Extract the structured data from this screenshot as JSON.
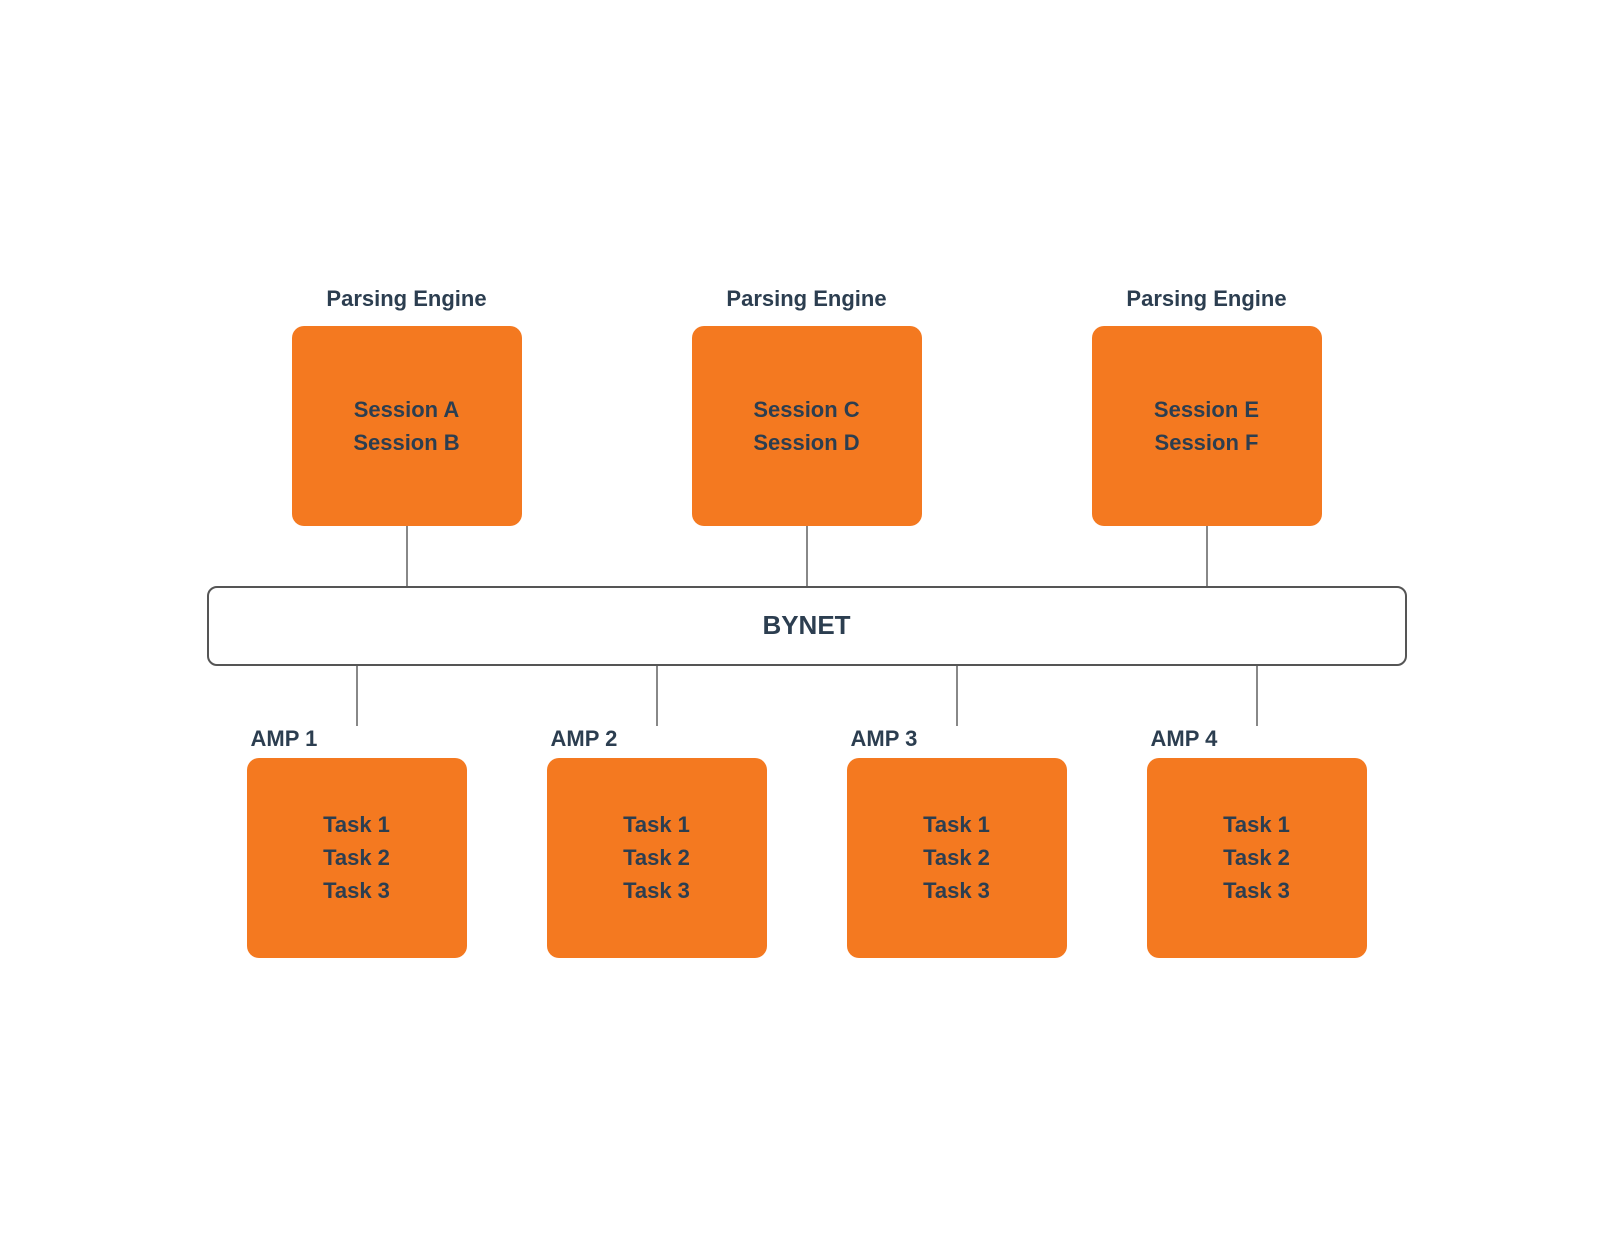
{
  "diagram": {
    "parsing_engines": [
      {
        "label": "Parsing Engine",
        "sessions": [
          "Session A",
          "Session B"
        ]
      },
      {
        "label": "Parsing Engine",
        "sessions": [
          "Session C",
          "Session D"
        ]
      },
      {
        "label": "Parsing Engine",
        "sessions": [
          "Session E",
          "Session F"
        ]
      }
    ],
    "bynet_label": "BYNET",
    "amps": [
      {
        "label": "AMP 1",
        "tasks": [
          "Task 1",
          "Task 2",
          "Task 3"
        ]
      },
      {
        "label": "AMP 2",
        "tasks": [
          "Task 1",
          "Task 2",
          "Task 3"
        ]
      },
      {
        "label": "AMP 3",
        "tasks": [
          "Task 1",
          "Task 2",
          "Task 3"
        ]
      },
      {
        "label": "AMP 4",
        "tasks": [
          "Task 1",
          "Task 2",
          "Task 3"
        ]
      }
    ]
  }
}
